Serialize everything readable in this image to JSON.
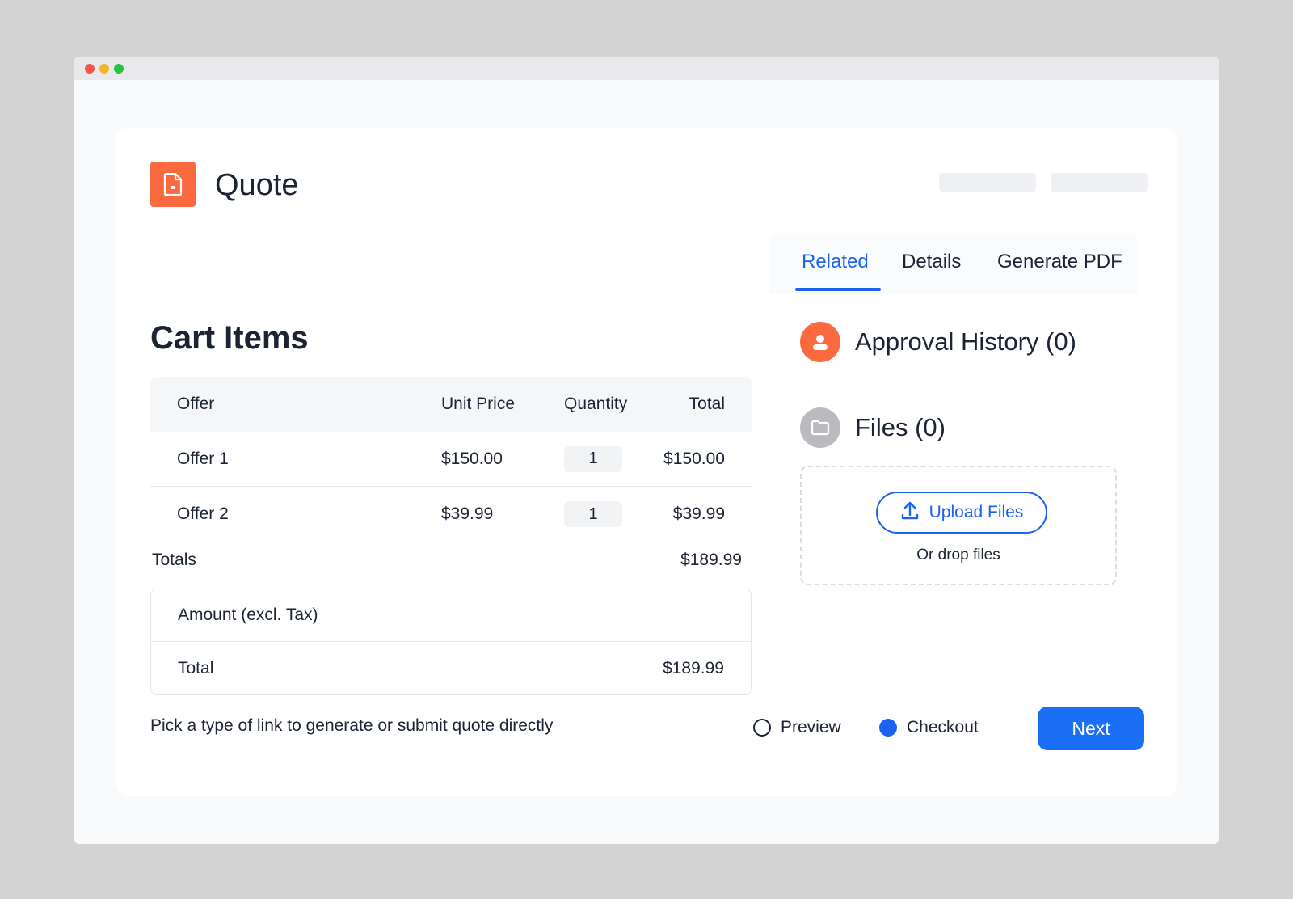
{
  "header": {
    "title": "Quote",
    "doc_icon": "document-icon"
  },
  "cart": {
    "title": "Cart Items",
    "columns": [
      "Offer",
      "Unit Price",
      "Quantity",
      "Total"
    ],
    "rows": [
      {
        "offer": "Offer 1",
        "unit_price": "$150.00",
        "quantity": "1",
        "total": "$150.00"
      },
      {
        "offer": "Offer 2",
        "unit_price": "$39.99",
        "quantity": "1",
        "total": "$39.99"
      }
    ],
    "totals_label": "Totals",
    "totals_value": "$189.99",
    "summary": {
      "amount_label": "Amount (excl. Tax)",
      "total_label": "Total",
      "total_value": "$189.99"
    }
  },
  "footer": {
    "hint": "Pick a type of link to generate or submit quote directly",
    "options": [
      {
        "label": "Preview",
        "selected": false
      },
      {
        "label": "Checkout",
        "selected": true
      }
    ],
    "next_label": "Next"
  },
  "panel": {
    "tabs": [
      {
        "label": "Related",
        "active": true
      },
      {
        "label": "Details",
        "active": false
      },
      {
        "label": "Generate PDF",
        "active": false
      }
    ],
    "approval": {
      "label": "Approval History (0)",
      "icon": "user-icon"
    },
    "files": {
      "label": "Files (0)",
      "icon": "folder-icon",
      "upload_label": "Upload Files",
      "drop_hint": "Or drop files"
    }
  },
  "colors": {
    "accent": "#1a62f2",
    "brand_orange": "#fb6a3f",
    "files_grey": "#b9bbbe"
  }
}
